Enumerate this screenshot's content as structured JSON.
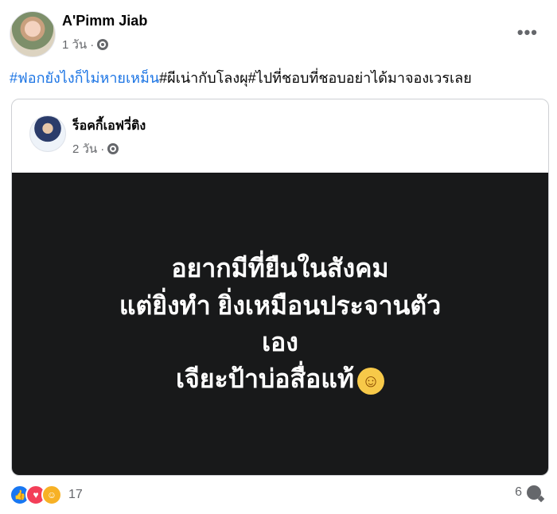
{
  "post": {
    "author": "A'Pimm Jiab",
    "time": "1 วัน",
    "dot": "·",
    "caption": {
      "hashtag": "#ฟอกยังไงก็ไม่หายเหม็น",
      "rest": "#ผีเน่ากับโลงผุ#ไปที่ชอบที่ชอบอย่าได้มาจองเวรเลย"
    }
  },
  "shared": {
    "author": "ร็อคกี้เอฟวี่ติง",
    "time": "2 วัน",
    "dot": "·",
    "quote_lines": [
      "อยากมีที่ยืนในสังคม",
      "แต่ยิ่งทำ ยิ่งเหมือนประจานตัว",
      "เอง",
      "เจียะป้าบ่อสื่อแท้"
    ],
    "emoji": "☺"
  },
  "footer": {
    "reaction_count": "17",
    "comment_count": "6"
  },
  "icons": {
    "more": "more-horizontal-icon",
    "globe": "globe-icon",
    "like": "like-reaction-icon",
    "love": "love-reaction-icon",
    "care": "care-reaction-icon",
    "comment": "comment-icon"
  },
  "colors": {
    "hashtag": "#1b74e4",
    "quote_background": "#18191a",
    "meta_text": "#65676b"
  }
}
